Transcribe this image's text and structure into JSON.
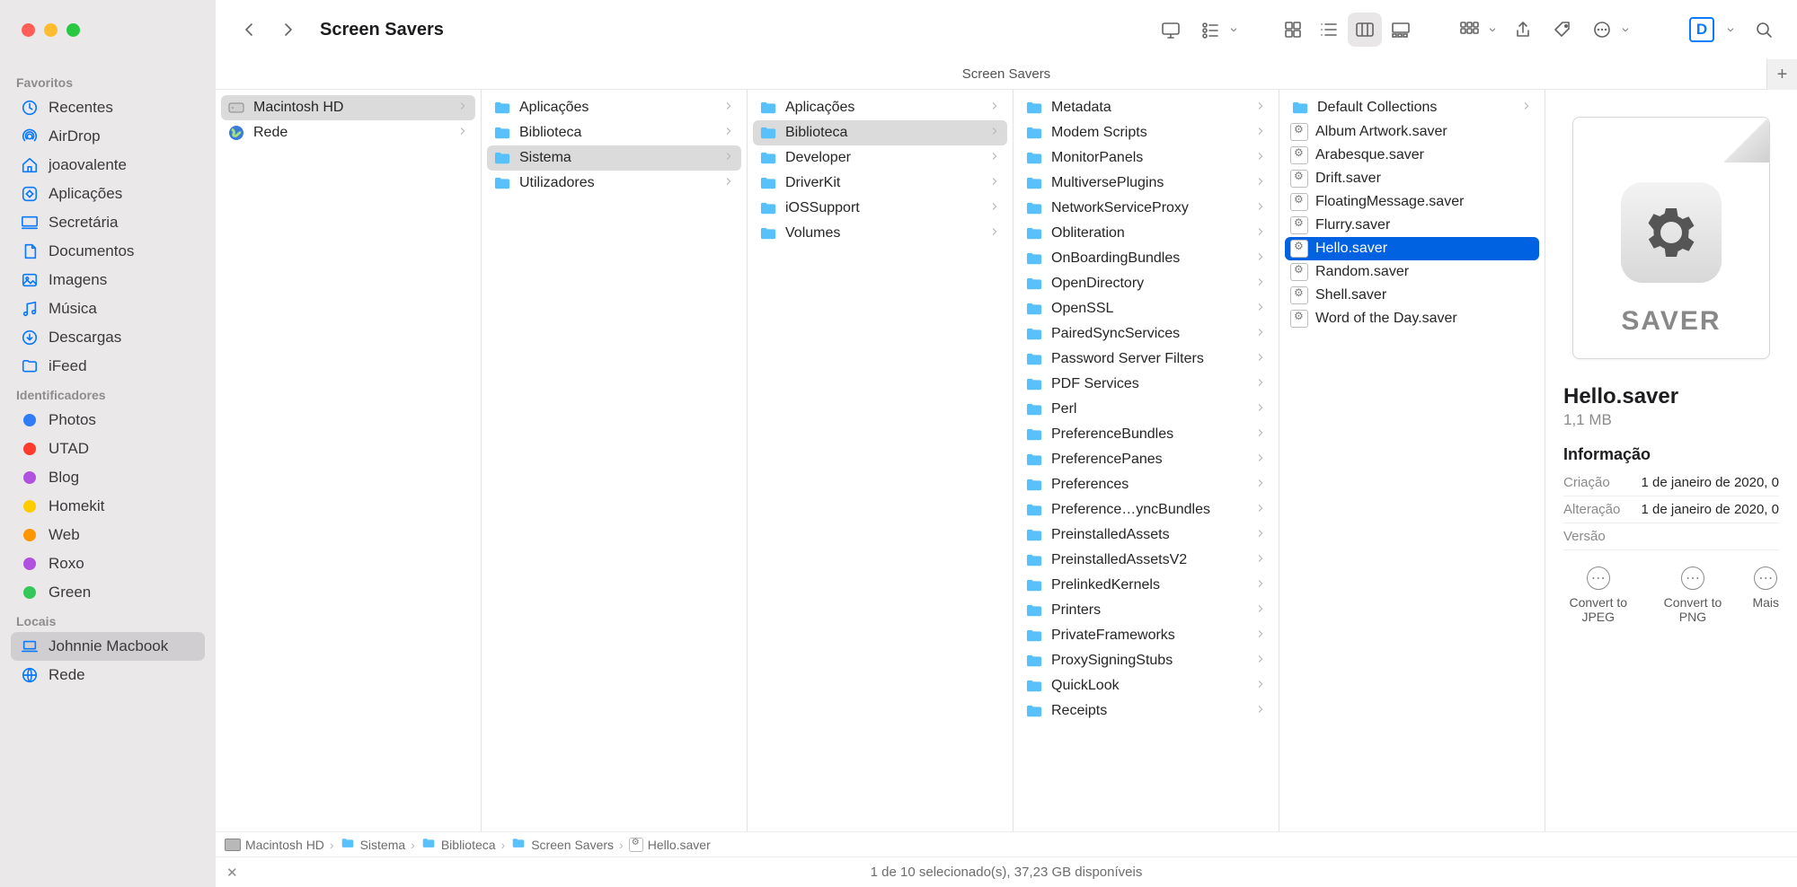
{
  "window_title": "Screen Savers",
  "subheader_title": "Screen Savers",
  "sidebar": {
    "sections": [
      {
        "label": "Favoritos",
        "items": [
          {
            "label": "Recentes",
            "icon": "clock"
          },
          {
            "label": "AirDrop",
            "icon": "airdrop"
          },
          {
            "label": "joaovalente",
            "icon": "house"
          },
          {
            "label": "Aplicações",
            "icon": "app"
          },
          {
            "label": "Secretária",
            "icon": "desktop"
          },
          {
            "label": "Documentos",
            "icon": "doc"
          },
          {
            "label": "Imagens",
            "icon": "image"
          },
          {
            "label": "Música",
            "icon": "music"
          },
          {
            "label": "Descargas",
            "icon": "download"
          },
          {
            "label": "iFeed",
            "icon": "folder-sb"
          }
        ]
      },
      {
        "label": "Identificadores",
        "items": [
          {
            "label": "Photos",
            "tag": "#2f7cf6"
          },
          {
            "label": "UTAD",
            "tag": "#ff3b30"
          },
          {
            "label": "Blog",
            "tag": "#af52de"
          },
          {
            "label": "Homekit",
            "tag": "#ffcc00"
          },
          {
            "label": "Web",
            "tag": "#ff9500"
          },
          {
            "label": "Roxo",
            "tag": "#af52de"
          },
          {
            "label": "Green",
            "tag": "#34c759"
          }
        ]
      },
      {
        "label": "Locais",
        "items": [
          {
            "label": "Johnnie Macbook",
            "icon": "laptop",
            "selected": true
          },
          {
            "label": "Rede",
            "icon": "globe-sb"
          }
        ]
      }
    ]
  },
  "columns": [
    [
      {
        "label": "Macintosh HD",
        "type": "hd",
        "on_path": true,
        "chev": true
      },
      {
        "label": "Rede",
        "type": "globe",
        "chev": true
      }
    ],
    [
      {
        "label": "Aplicações",
        "type": "folder",
        "chev": true
      },
      {
        "label": "Biblioteca",
        "type": "folder",
        "chev": true
      },
      {
        "label": "Sistema",
        "type": "folder",
        "chev": true,
        "on_path": true
      },
      {
        "label": "Utilizadores",
        "type": "folder",
        "chev": true
      }
    ],
    [
      {
        "label": "Aplicações",
        "type": "folder",
        "chev": true
      },
      {
        "label": "Biblioteca",
        "type": "folder",
        "chev": true,
        "on_path": true
      },
      {
        "label": "Developer",
        "type": "folder",
        "chev": true
      },
      {
        "label": "DriverKit",
        "type": "folder",
        "chev": true
      },
      {
        "label": "iOSSupport",
        "type": "folder",
        "chev": true
      },
      {
        "label": "Volumes",
        "type": "folder",
        "chev": true
      }
    ],
    [
      {
        "label": "Metadata",
        "type": "folder",
        "chev": true
      },
      {
        "label": "Modem Scripts",
        "type": "folder",
        "chev": true
      },
      {
        "label": "MonitorPanels",
        "type": "folder",
        "chev": true
      },
      {
        "label": "MultiversePlugins",
        "type": "folder",
        "chev": true
      },
      {
        "label": "NetworkServiceProxy",
        "type": "folder",
        "chev": true
      },
      {
        "label": "Obliteration",
        "type": "folder",
        "chev": true
      },
      {
        "label": "OnBoardingBundles",
        "type": "folder",
        "chev": true
      },
      {
        "label": "OpenDirectory",
        "type": "folder",
        "chev": true
      },
      {
        "label": "OpenSSL",
        "type": "folder",
        "chev": true
      },
      {
        "label": "PairedSyncServices",
        "type": "folder",
        "chev": true
      },
      {
        "label": "Password Server Filters",
        "type": "folder",
        "chev": true
      },
      {
        "label": "PDF Services",
        "type": "folder",
        "chev": true
      },
      {
        "label": "Perl",
        "type": "folder",
        "chev": true
      },
      {
        "label": "PreferenceBundles",
        "type": "folder",
        "chev": true
      },
      {
        "label": "PreferencePanes",
        "type": "folder",
        "chev": true
      },
      {
        "label": "Preferences",
        "type": "folder",
        "chev": true
      },
      {
        "label": "Preference…yncBundles",
        "type": "folder",
        "chev": true
      },
      {
        "label": "PreinstalledAssets",
        "type": "folder",
        "chev": true
      },
      {
        "label": "PreinstalledAssetsV2",
        "type": "folder",
        "chev": true
      },
      {
        "label": "PrelinkedKernels",
        "type": "folder",
        "chev": true
      },
      {
        "label": "Printers",
        "type": "folder",
        "chev": true
      },
      {
        "label": "PrivateFrameworks",
        "type": "folder",
        "chev": true
      },
      {
        "label": "ProxySigningStubs",
        "type": "folder",
        "chev": true
      },
      {
        "label": "QuickLook",
        "type": "folder",
        "chev": true
      },
      {
        "label": "Receipts",
        "type": "folder",
        "chev": true
      }
    ],
    [
      {
        "label": "Default Collections",
        "type": "folder",
        "chev": true
      },
      {
        "label": "Album Artwork.saver",
        "type": "saver"
      },
      {
        "label": "Arabesque.saver",
        "type": "saver"
      },
      {
        "label": "Drift.saver",
        "type": "saver"
      },
      {
        "label": "FloatingMessage.saver",
        "type": "saver"
      },
      {
        "label": "Flurry.saver",
        "type": "saver"
      },
      {
        "label": "Hello.saver",
        "type": "saver",
        "selected": true
      },
      {
        "label": "Random.saver",
        "type": "saver"
      },
      {
        "label": "Shell.saver",
        "type": "saver"
      },
      {
        "label": "Word of the Day.saver",
        "type": "saver"
      }
    ]
  ],
  "preview": {
    "ext_label": "SAVER",
    "name": "Hello.saver",
    "size": "1,1 MB",
    "info_label": "Informação",
    "rows": [
      {
        "k": "Criação",
        "v": "1 de janeiro de 2020, 0"
      },
      {
        "k": "Alteração",
        "v": "1 de janeiro de 2020, 0"
      },
      {
        "k": "Versão",
        "v": ""
      }
    ],
    "actions": [
      {
        "label": "Convert to JPEG"
      },
      {
        "label": "Convert to PNG"
      },
      {
        "label": "Mais"
      }
    ]
  },
  "pathbar": [
    {
      "label": "Macintosh HD",
      "icon": "hd"
    },
    {
      "label": "Sistema",
      "icon": "folder"
    },
    {
      "label": "Biblioteca",
      "icon": "folder"
    },
    {
      "label": "Screen Savers",
      "icon": "folder"
    },
    {
      "label": "Hello.saver",
      "icon": "saver"
    }
  ],
  "status": "1 de 10 selecionado(s), 37,23 GB disponíveis"
}
